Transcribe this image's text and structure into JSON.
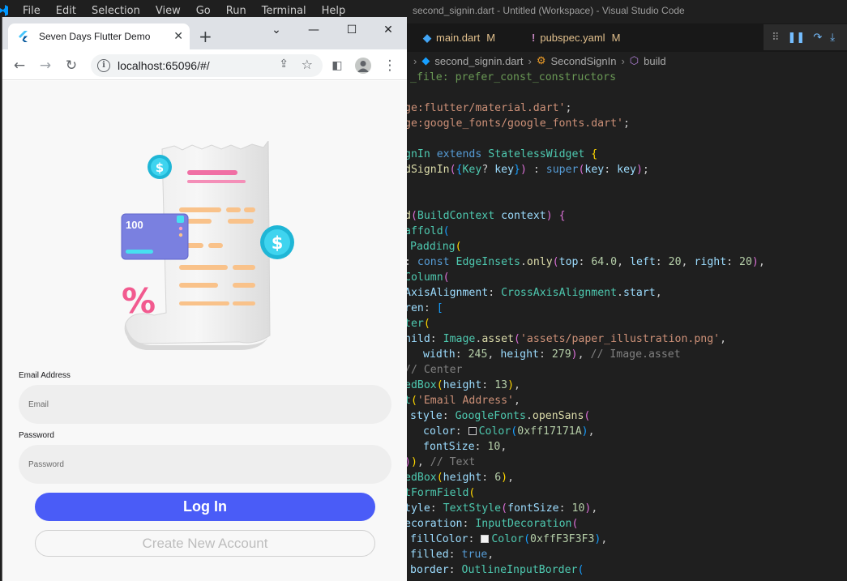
{
  "vscode": {
    "menu": [
      "File",
      "Edit",
      "Selection",
      "View",
      "Go",
      "Run",
      "Terminal",
      "Help"
    ],
    "window_title": "second_signin.dart - Untitled (Workspace) - Visual Studio Code",
    "tabs": [
      {
        "name": "main.dart",
        "status": "M",
        "icon": "dart-icon"
      },
      {
        "name": "pubspec.yaml",
        "status": "M",
        "icon": "yaml-icon"
      }
    ],
    "breadcrumb": {
      "file": "second_signin.dart",
      "class": "SecondSignIn",
      "method": "build"
    },
    "accent": "#75beff"
  },
  "browser": {
    "tab_title": "Seven Days Flutter Demo",
    "url": "localhost:65096/#/"
  },
  "app": {
    "email_label": "Email Address",
    "email_placeholder": "Email",
    "password_label": "Password",
    "password_placeholder": "Password",
    "login_label": "Log In",
    "create_label": "Create New Account",
    "illustration": {
      "card_amount": "100",
      "coin_symbol": "$",
      "percent_symbol": "%"
    },
    "primary_color": "#4a5cf7"
  }
}
